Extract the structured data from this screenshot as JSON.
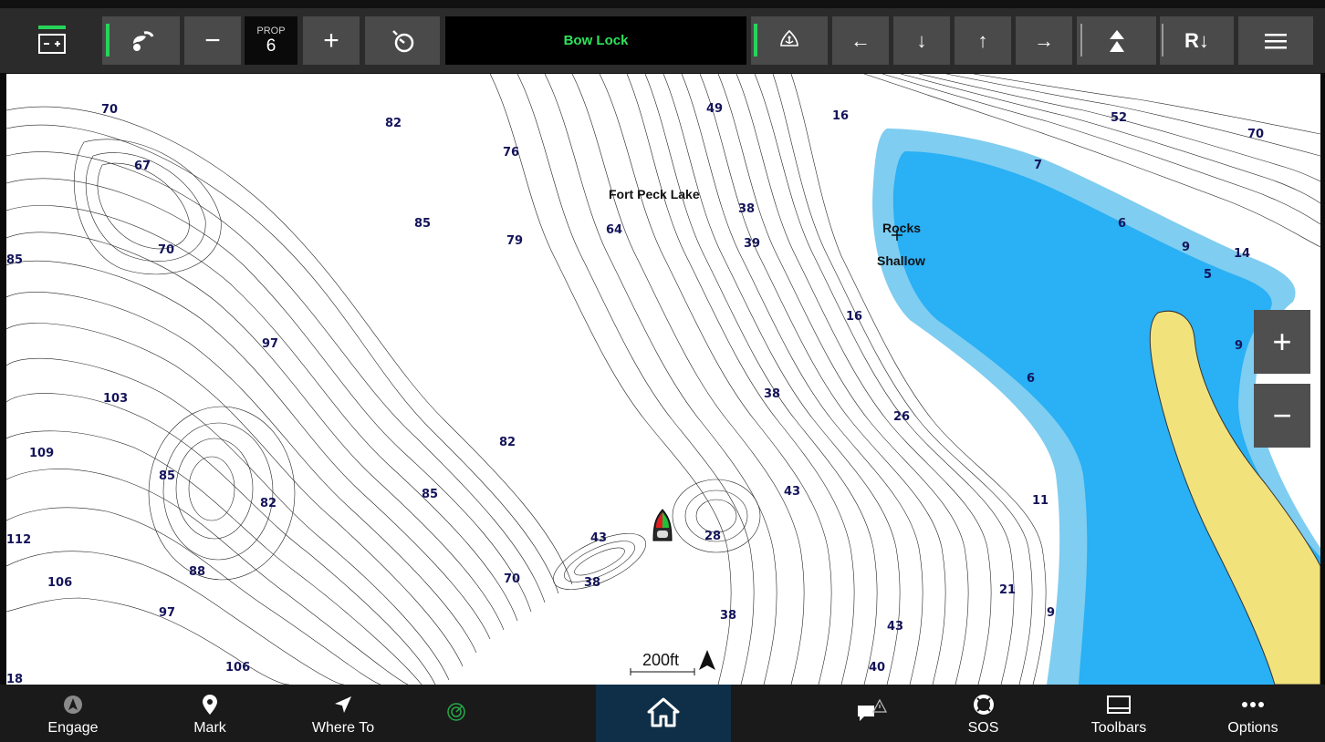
{
  "topbar": {
    "battery_icon": "battery-icon",
    "trolling_motor_icon": "trolling-motor-icon",
    "minus_label": "−",
    "prop": {
      "label": "PROP",
      "value": "6"
    },
    "plus_label": "+",
    "cruise_icon": "cruise-timer-icon",
    "status_text": "Bow Lock",
    "anchor_icon": "anchor-lock-icon",
    "jog_left": "←",
    "jog_down": "↓",
    "jog_up": "↑",
    "jog_right": "→",
    "raise_icon": "stow-deploy-icon",
    "record_label": "R↓",
    "menu_icon": "menu-icon"
  },
  "map": {
    "labels": [
      {
        "text": "Fort Peck Lake"
      },
      {
        "text": "Rocks"
      },
      {
        "text": "Shallow"
      }
    ],
    "depths": [
      "70",
      "67",
      "70",
      "82",
      "85",
      "76",
      "79",
      "49",
      "16",
      "38",
      "39",
      "64",
      "52",
      "70",
      "7",
      "6",
      "9",
      "14",
      "5",
      "16",
      "97",
      "103",
      "109",
      "85",
      "82",
      "85",
      "82",
      "38",
      "26",
      "6",
      "43",
      "11",
      "9",
      "43",
      "28",
      "38",
      "88",
      "97",
      "106",
      "70",
      "38",
      "21",
      "9",
      "43",
      "106",
      "112",
      "40",
      "18",
      "85"
    ],
    "scale": "200ft",
    "zoom_in": "+",
    "zoom_out": "−",
    "colors": {
      "land": "#ffffff",
      "shallow": "#7fcdf0",
      "water": "#29b0f5",
      "shore": "#f2e27c",
      "contour": "#222222"
    }
  },
  "bottombar": {
    "items": [
      {
        "label": "Engage",
        "icon": "engage-icon"
      },
      {
        "label": "Mark",
        "icon": "pin-icon"
      },
      {
        "label": "Where To",
        "icon": "navigate-arrow-icon"
      },
      {
        "label": "",
        "icon": "sonar-icon"
      },
      {
        "label": "",
        "icon": "home-icon"
      },
      {
        "label": "",
        "icon": "alert-message-icon"
      },
      {
        "label": "SOS",
        "icon": "lifebuoy-icon"
      },
      {
        "label": "Toolbars",
        "icon": "toolbar-icon"
      },
      {
        "label": "Options",
        "icon": "more-icon"
      }
    ]
  }
}
